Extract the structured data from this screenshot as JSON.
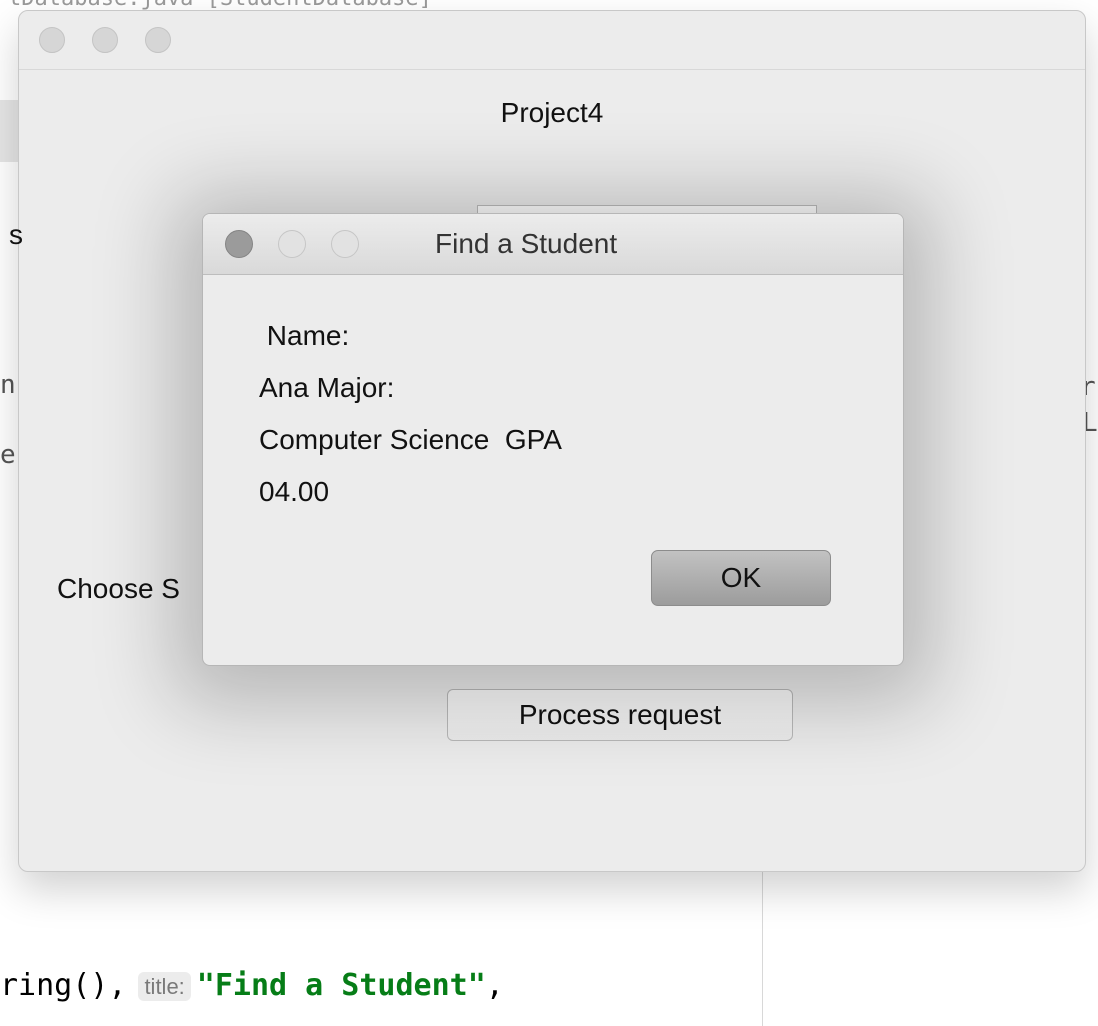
{
  "ide": {
    "top_fragment": "tDatabase.java [StudentDatabase]",
    "code": {
      "prefix": "ring(),",
      "hint": "title:",
      "string": "\"Find a Student\"",
      "suffix": ","
    },
    "edge_chars": [
      "n",
      "r",
      "e",
      "L"
    ]
  },
  "main_window": {
    "title": "Project4",
    "side_fragment": "s",
    "choose_label": "Choose S",
    "process_button": "Process request"
  },
  "dialog": {
    "title": "Find a Student",
    "message_lines": [
      " Name:",
      "Ana Major:",
      "Computer Science  GPA",
      "04.00"
    ],
    "ok_button": "OK"
  }
}
